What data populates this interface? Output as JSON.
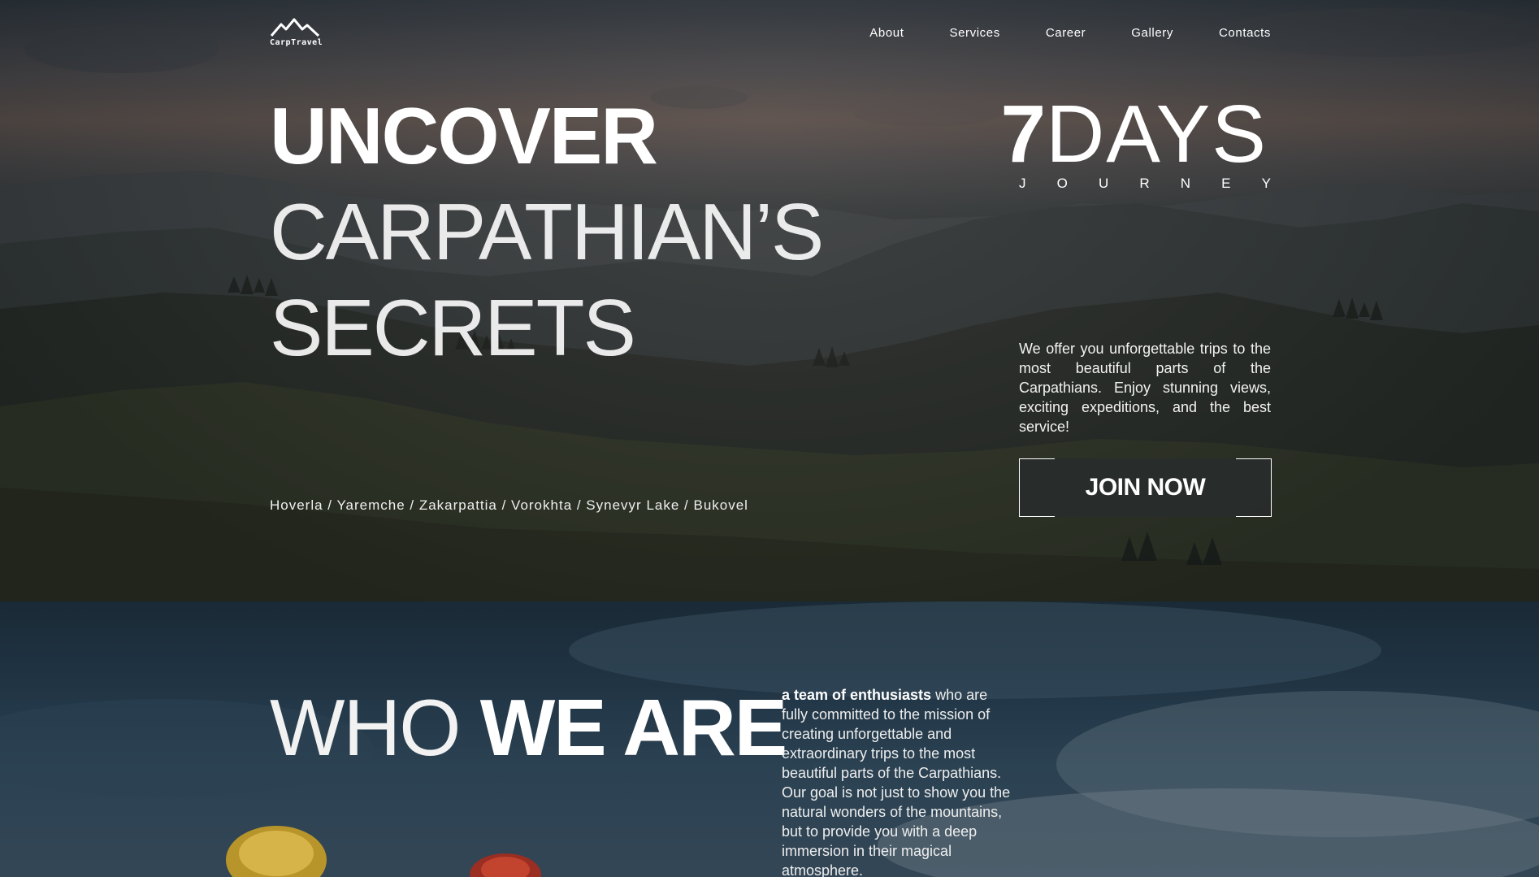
{
  "brand": {
    "logo_text": "CarpTravel"
  },
  "nav": {
    "items": [
      "About",
      "Services",
      "Career",
      "Gallery",
      "Contacts"
    ]
  },
  "hero": {
    "headline_bold": "UNCOVER",
    "headline_line2": "CARPATHIAN’S",
    "headline_line3": "SECRETS",
    "days_number": "7",
    "days_word": "DAYS",
    "journey_letters": [
      "J",
      "O",
      "U",
      "R",
      "N",
      "E",
      "Y"
    ],
    "description": "We offer you unforgettable trips to the most beautiful parts of the Carpathians. Enjoy stunning views, exciting expeditions, and the best service!",
    "cta_label": "JOIN NOW",
    "places": "Hoverla / Yaremche / Zakarpattia / Vorokhta / Synevyr Lake / Bukovel"
  },
  "who": {
    "title_light": "WHO",
    "title_bold": "WE ARE",
    "text_strong": "a team of enthusiasts",
    "text_rest": " who are fully committed to the mission of creating unforgettable and extraordinary trips to the most beautiful parts of the Carpathians. Our goal is not just to show you the natural wonders of the mountains, but to provide you with a deep immersion in their magical atmosphere."
  },
  "icons": {
    "logo": "mountain-logo-icon"
  }
}
